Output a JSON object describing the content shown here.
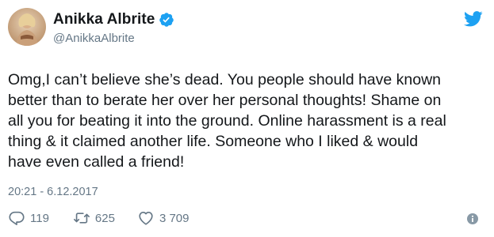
{
  "tweet": {
    "display_name": "Anikka Albrite",
    "handle": "@AnikkaAlbrite",
    "text": "Omg,I can’t believe she’s dead. You people should have known\nbetter than to berate her over her personal thoughts! Shame on\nall you for beating it into the ground. Online harassment is a real\nthing & it claimed another life. Someone who I liked & would\nhave even called a friend!",
    "timestamp": "20:21 - 6.12.2017"
  },
  "actions": {
    "reply_count": "119",
    "retweet_count": "625",
    "like_count": "3 709"
  },
  "icons": {
    "avatar": "avatar-image",
    "verified": "verified-badge-icon",
    "brand": "twitter-bird-icon",
    "reply": "reply-icon",
    "retweet": "retweet-icon",
    "like": "heart-icon",
    "info": "info-icon"
  },
  "colors": {
    "brand_blue": "#1da1f2",
    "text": "#14171a",
    "muted": "#657786"
  }
}
